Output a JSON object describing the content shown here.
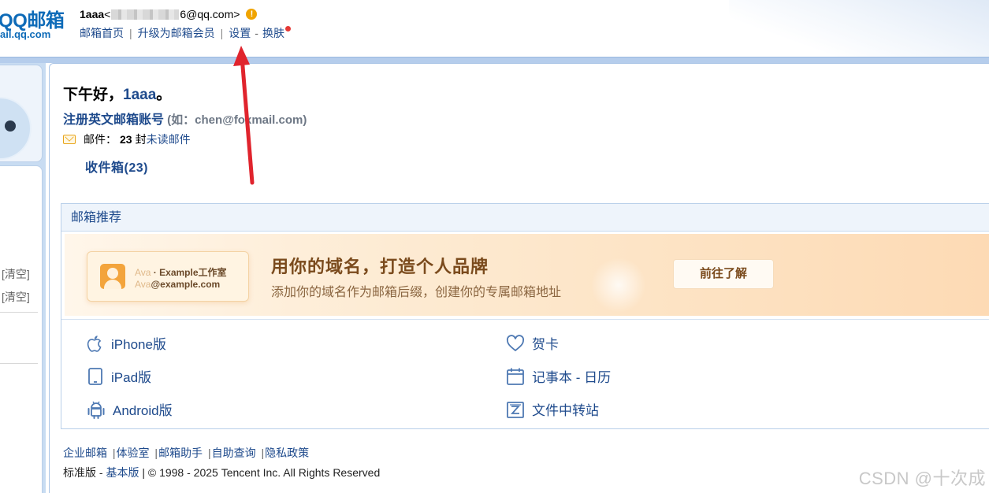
{
  "header": {
    "logo_title": "QQ邮箱",
    "logo_sub": "ail.qq.com",
    "user_name": "1aaa",
    "user_email_prefix": "<",
    "user_email_suffix": "6@qq.com>",
    "warning_glyph": "!",
    "nav": {
      "home": "邮箱首页",
      "upgrade": "升级为邮箱会员",
      "settings": "设置",
      "dash": "-",
      "skin": "换肤",
      "sep": "|"
    }
  },
  "sidebar": {
    "clear_1": "[清空]",
    "clear_2": "[清空]"
  },
  "main": {
    "greeting_prefix": "下午好，",
    "greeting_name": "1aaa",
    "greeting_suffix": "。",
    "register_link": "注册英文邮箱账号",
    "register_hint": " (如：chen@foxmail.com)",
    "mail_label": "邮件：",
    "mail_count": "23",
    "mail_unit": "封",
    "unread_link": "未读邮件",
    "inbox_link": "收件箱(23)"
  },
  "recommend": {
    "title": "邮箱推荐",
    "banner": {
      "card_name": "Ava",
      "card_dot": " · ",
      "card_studio": "Example工作室",
      "card_name2": "Ava",
      "card_domain": "@example.com",
      "headline": "用你的域名，打造个人品牌",
      "subline": "添加你的域名作为邮箱后缀，创建你的专属邮箱地址",
      "button": "前往了解"
    },
    "apps": {
      "iphone": "iPhone版",
      "ipad": "iPad版",
      "android": "Android版",
      "card": "贺卡",
      "notebook": "记事本 - 日历",
      "transfer": "文件中转站"
    }
  },
  "footer": {
    "links": [
      "企业邮箱",
      "体验室",
      "邮箱助手",
      "自助查询",
      "隐私政策"
    ],
    "sep": "|",
    "standard": "标准版",
    "dash": " - ",
    "basic": "基本版",
    "copyright": " | © 1998 - 2025 Tencent Inc. All Rights Reserved"
  },
  "watermark": "CSDN @十次成",
  "colors": {
    "link_blue": "#1e4a8c",
    "header_band": "#b5cdec",
    "annotation_red": "#e0242d",
    "banner_text": "#7a4a1c"
  }
}
